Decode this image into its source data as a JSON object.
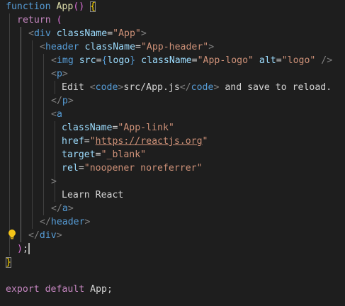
{
  "code": {
    "l1": {
      "kw": "function",
      "name": "App",
      "parens": "()",
      "brace": "{"
    },
    "l2": {
      "kw": "return",
      "paren": "("
    },
    "l3": {
      "lt": "<",
      "tag": "div",
      "attr": "className",
      "eq": "=",
      "val": "\"App\"",
      "gt": ">"
    },
    "l4": {
      "lt": "<",
      "tag": "header",
      "attr": "className",
      "eq": "=",
      "val": "\"App-header\"",
      "gt": ">"
    },
    "l5": {
      "lt": "<",
      "tag": "img",
      "attr1": "src",
      "eq1": "=",
      "expr_open": "{",
      "expr": "logo",
      "expr_close": "}",
      "attr2": "className",
      "eq2": "=",
      "val2": "\"App-logo\"",
      "attr3": "alt",
      "eq3": "=",
      "val3": "\"logo\"",
      "close": "/>"
    },
    "l6": {
      "lt": "<",
      "tag": "p",
      "gt": ">"
    },
    "l7": {
      "text1": "Edit ",
      "code_open_lt": "<",
      "code_tag": "code",
      "code_open_gt": ">",
      "path": "src/App.js",
      "code_close_lt": "</",
      "code_close_tag": "code",
      "code_close_gt": ">",
      "text2": " and save to reload."
    },
    "l8": {
      "lt": "</",
      "tag": "p",
      "gt": ">"
    },
    "l9": {
      "lt": "<",
      "tag": "a"
    },
    "l10": {
      "attr": "className",
      "eq": "=",
      "val": "\"App-link\""
    },
    "l11": {
      "attr": "href",
      "eq": "=",
      "q1": "\"",
      "url": "https://reactjs.org",
      "q2": "\""
    },
    "l12": {
      "attr": "target",
      "eq": "=",
      "val": "\"_blank\""
    },
    "l13": {
      "attr": "rel",
      "eq": "=",
      "val": "\"noopener noreferrer\""
    },
    "l14": {
      "gt": ">"
    },
    "l15": {
      "text": "Learn React"
    },
    "l16": {
      "lt": "</",
      "tag": "a",
      "gt": ">"
    },
    "l17": {
      "lt": "</",
      "tag": "header",
      "gt": ">"
    },
    "l18": {
      "lt": "</",
      "tag": "div",
      "gt": ">"
    },
    "l19": {
      "paren": ")",
      "semi": ";"
    },
    "l20": {
      "brace": "}"
    },
    "l22": {
      "kw1": "export",
      "kw2": "default",
      "name": "App",
      "semi": ";"
    }
  },
  "icons": {
    "lightbulb": "lightbulb-icon",
    "color": "#f5c518"
  },
  "colors": {
    "background": "#1e1e1e",
    "keyword": "#569cd6",
    "control": "#c586c0",
    "function": "#dcdcaa",
    "attribute": "#9cdcfe",
    "string": "#ce9178",
    "tag_punct": "#808080",
    "text": "#d4d4d4",
    "bracket1": "#ffd700",
    "bracket2": "#da70d6"
  }
}
